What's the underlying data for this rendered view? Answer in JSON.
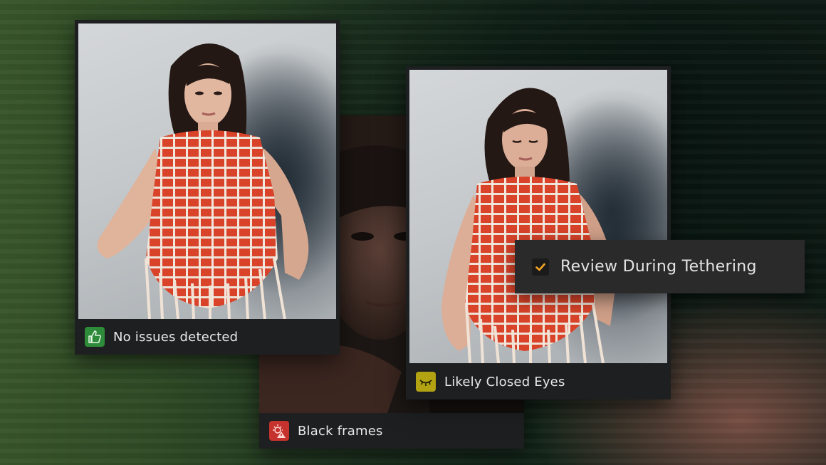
{
  "cards": {
    "left": {
      "label": "No issues detected",
      "icon": "thumbs-up-icon",
      "badge_color": "#2e8b3a"
    },
    "middle": {
      "label": "Black frames",
      "icon": "warning-light-icon",
      "badge_color": "#c6322d"
    },
    "right": {
      "label": "Likely Closed Eyes",
      "icon": "closed-eye-icon",
      "badge_color": "#b3a313"
    }
  },
  "tether_option": {
    "label": "Review During Tethering",
    "checked": true,
    "check_color": "#f5a623"
  }
}
